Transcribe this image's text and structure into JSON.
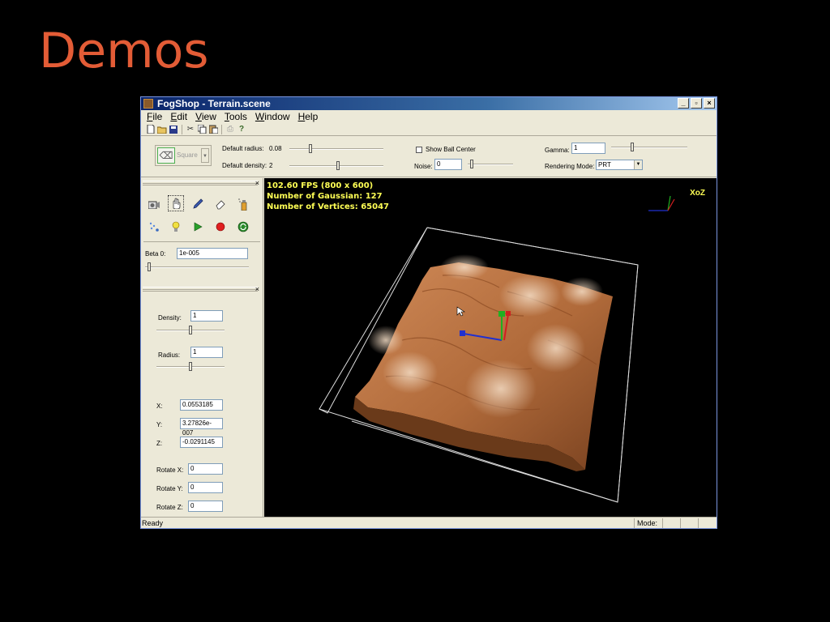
{
  "slide": {
    "title": "Demos"
  },
  "window": {
    "title": "FogShop - Terrain.scene",
    "min": "_",
    "max": "▫",
    "close": "×"
  },
  "menu": [
    "File",
    "Edit",
    "View",
    "Tools",
    "Window",
    "Help"
  ],
  "brush": {
    "shape": "Square"
  },
  "props": {
    "default_radius_label": "Default radius:",
    "default_radius_value": "0.08",
    "default_density_label": "Default density:",
    "default_density_value": "2",
    "show_ball_center_label": "Show Ball Center",
    "noise_label": "Noise:",
    "noise_value": "0",
    "gamma_label": "Gamma:",
    "gamma_value": "1",
    "rendering_mode_label": "Rendering Mode:",
    "rendering_mode_value": "PRT"
  },
  "tools_panel": {
    "beta_label": "Beta 0:",
    "beta_value": "1e-005"
  },
  "object_panel": {
    "density_label": "Density:",
    "density_value": "1",
    "radius_label": "Radius:",
    "radius_value": "1",
    "x_label": "X:",
    "x_value": "0.0553185",
    "y_label": "Y:",
    "y_value": "3.27826e-007",
    "z_label": "Z:",
    "z_value": "-0.0291145",
    "rotx_label": "Rotate X:",
    "rotx_value": "0",
    "roty_label": "Rotate Y:",
    "roty_value": "0",
    "rotz_label": "Rotate Z:",
    "rotz_value": "0"
  },
  "viewport": {
    "fps": "102.60 FPS (800 x 600)",
    "gaussians": "Number of Gaussian: 127",
    "vertices": "Number of Vertices: 65047",
    "axis_label": "XoZ"
  },
  "status": {
    "ready": "Ready",
    "mode": "Mode:"
  },
  "colors": {
    "title": "#e35c36",
    "terrain": "#c47a4a",
    "stats": "#ffff55"
  }
}
